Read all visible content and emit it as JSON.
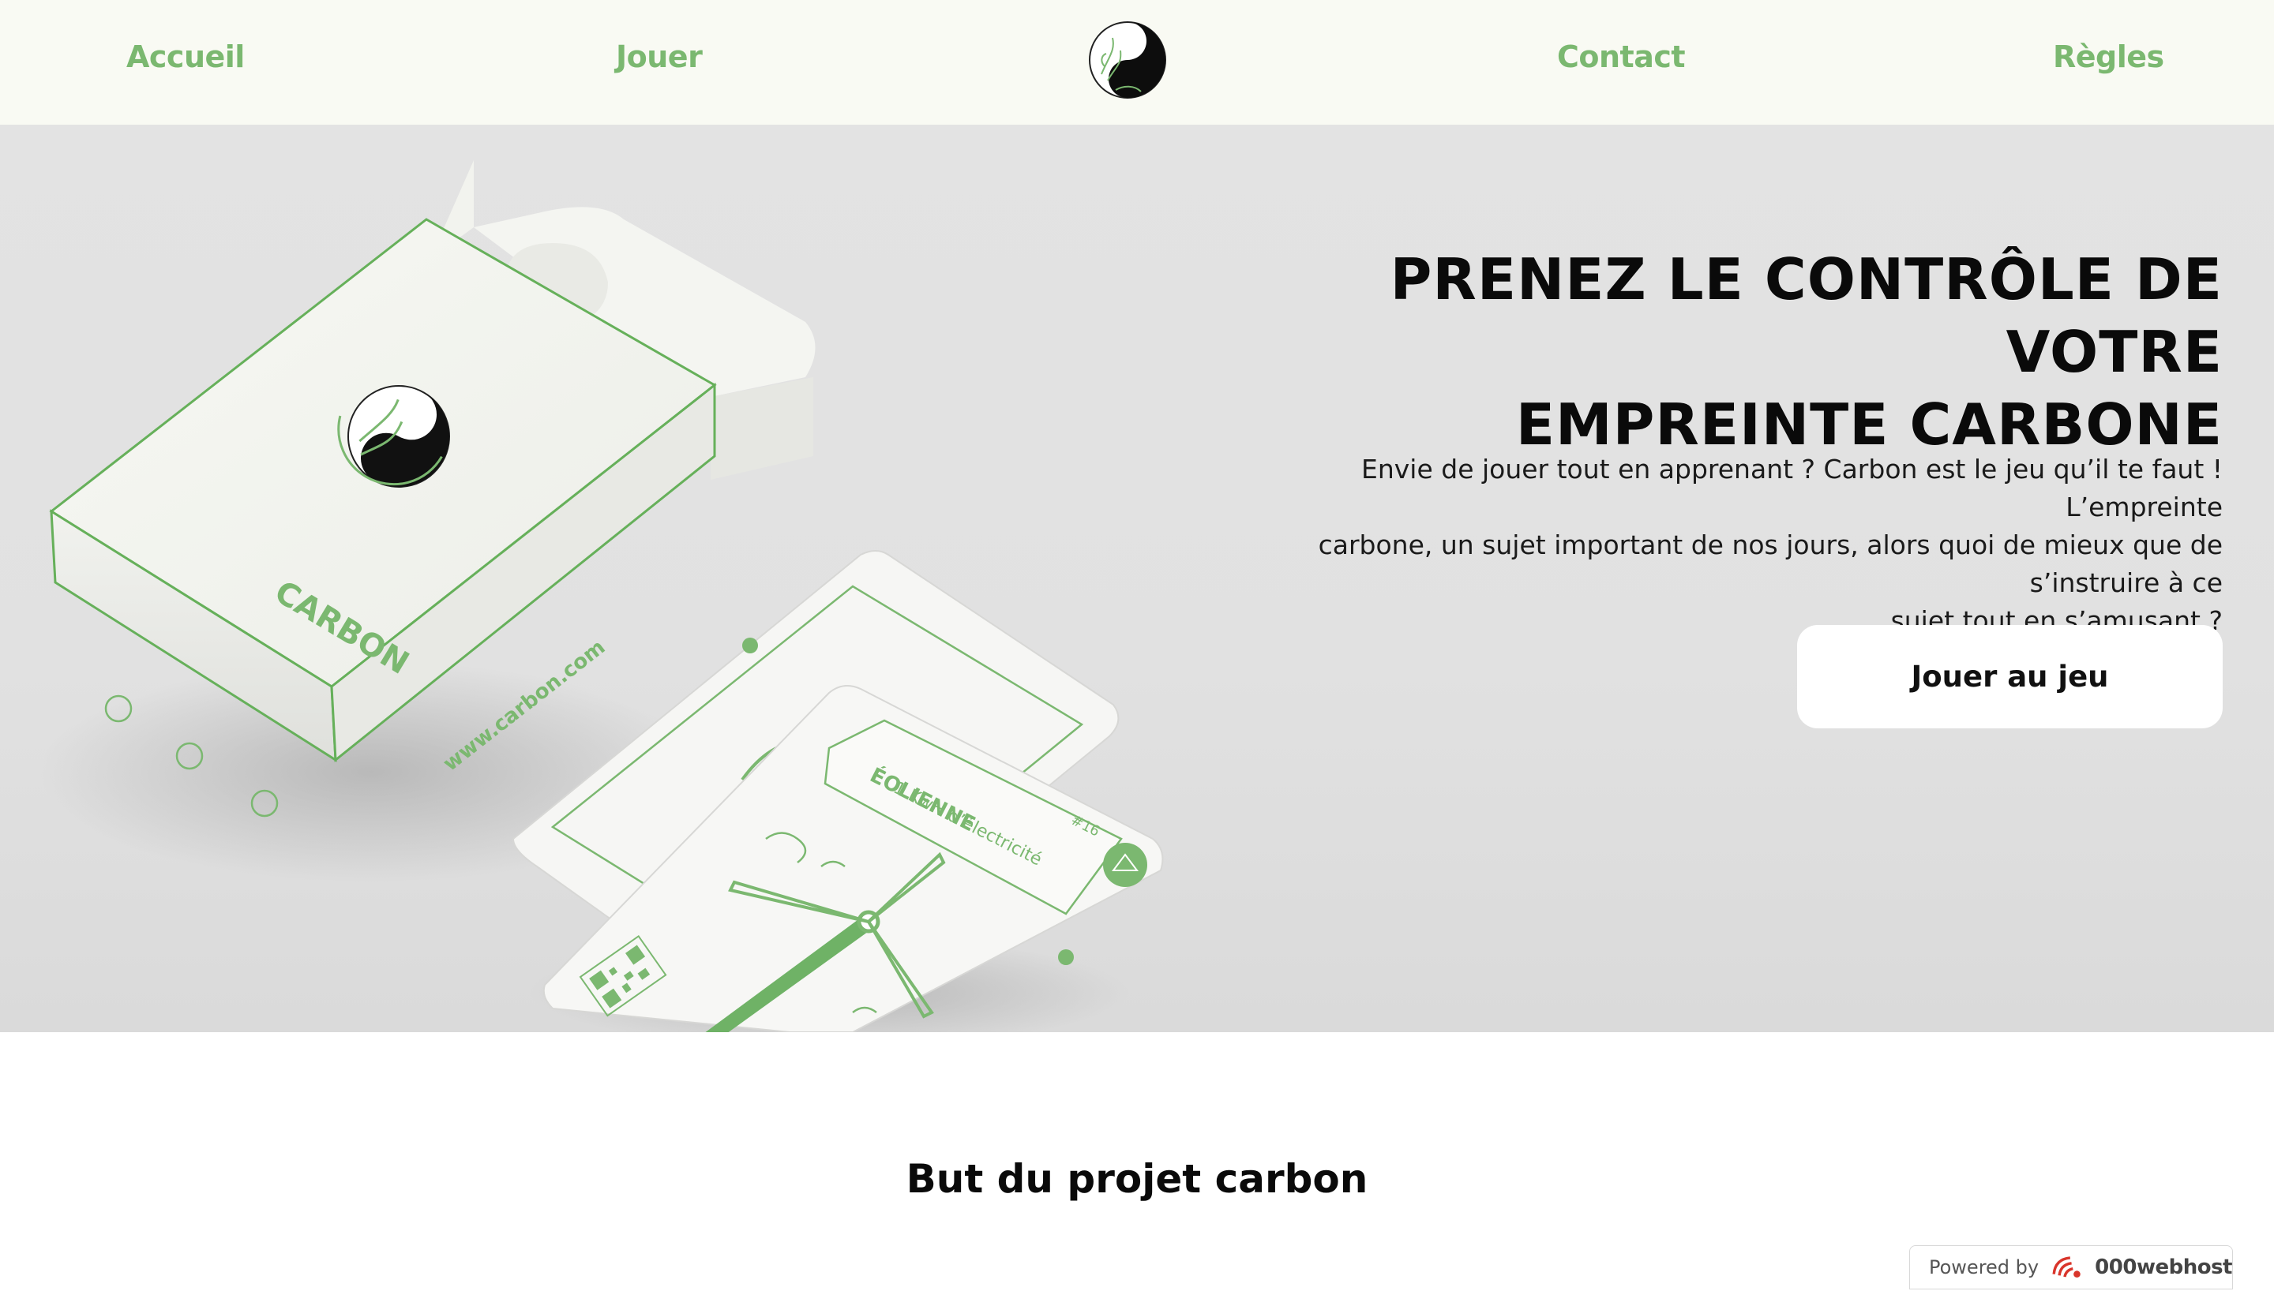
{
  "nav": {
    "items": [
      {
        "label": "Accueil"
      },
      {
        "label": "Jouer"
      },
      {
        "label": "Contact"
      },
      {
        "label": "Règles"
      }
    ],
    "logo_icon": "carbon-yin-yang-logo"
  },
  "hero": {
    "title_line1": "PRENEZ LE CONTRÔLE DE VOTRE",
    "title_line2": "EMPREINTE CARBONE",
    "text_line1": "Envie de jouer tout en apprenant ? Carbon est le jeu qu’il te faut ! L’empreinte",
    "text_line2": "carbone, un sujet important de nos jours, alors quoi de mieux que de s’instruire à ce",
    "text_line3": "sujet tout en s’amusant ?",
    "button_label": "Jouer au jeu",
    "image": {
      "box_brand": "CARBON",
      "box_url": "www.carbon.com",
      "card_title": "ÉOLIENNE",
      "card_subtitle": "1 KwH d’électricité",
      "card_number": "#16"
    }
  },
  "section": {
    "title": "But du projet carbon"
  },
  "badge": {
    "powered": "Powered by",
    "brand": "000webhost"
  },
  "colors": {
    "accent_green": "#7bb870",
    "nav_bg": "#f9faf3",
    "hero_bg": "#e2e2e2",
    "text_dark": "#0a0a0a"
  }
}
